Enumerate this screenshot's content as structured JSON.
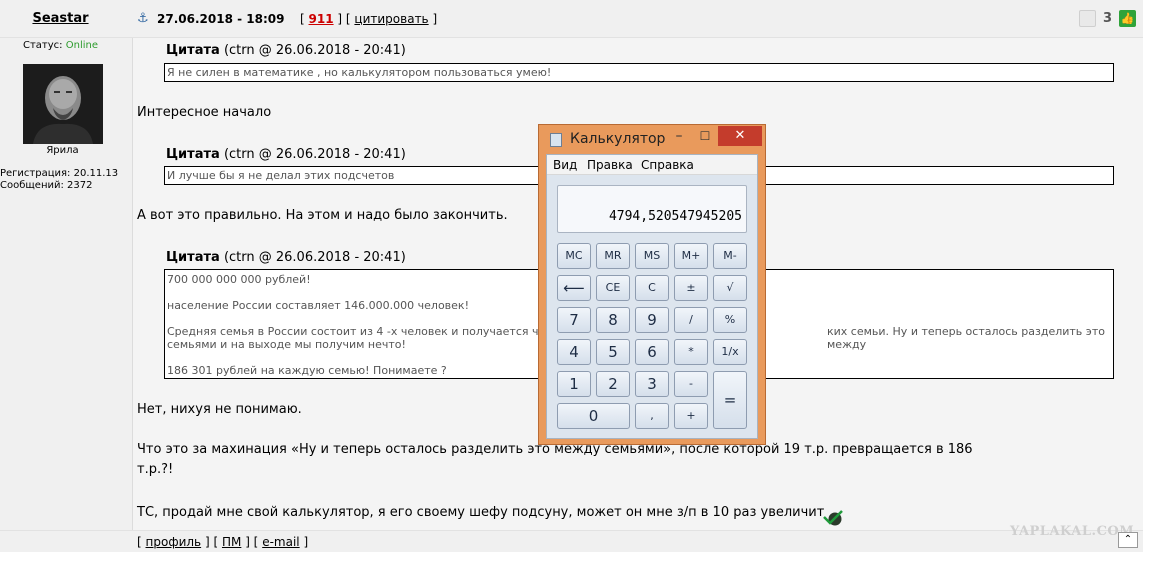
{
  "user": {
    "name": "Seastar",
    "status_label": "Статус:",
    "status_value": "Online",
    "avatar_caption": "Ярила",
    "registration": "Регистрация: 20.11.13",
    "messages": "Сообщений: 2372"
  },
  "post": {
    "date": "27.06.2018 - 18:09",
    "link_open": "[",
    "post_number": "911",
    "link_sep": "] [",
    "quote_link": "цитировать",
    "link_close": "]",
    "rating": "3"
  },
  "quotes": [
    {
      "author": "Цитата",
      "meta": "(ctrn @ 26.06.2018 - 20:41)",
      "lines": [
        "Я не силен в математике , но калькулятором пользоваться умею!"
      ]
    },
    {
      "author": "Цитата",
      "meta": "(ctrn @ 26.06.2018 - 20:41)",
      "lines": [
        "И лучше бы я не делал этих подсчетов"
      ]
    },
    {
      "author": "Цитата",
      "meta": "(ctrn @ 26.06.2018 - 20:41)",
      "lines": [
        "700 000 000 000 рублей!",
        "население России составляет 146.000.000 человек!",
        "Средняя семья в России состоит из 4 -х человек и получается что",
        "ких семьи. Ну и теперь осталось разделить это между",
        "семьями и на выходе мы получим нечто!",
        "186 301 рублей на каждую семью! Понимаете ?"
      ]
    }
  ],
  "paragraphs": [
    "Интересное начало",
    "А вот это правильно. На этом и надо было закончить.",
    "Нет, нихуя не понимаю.",
    "Что это за махинация «Ну и теперь осталось разделить это между семьями», после которой 19 т.р. превращается в 186",
    "т.р.?!",
    "ТС, продай мне свой калькулятор, я его своему шефу подсуну, может он мне з/п в 10 раз увеличит"
  ],
  "footer": {
    "open": "[",
    "profile": "профиль",
    "sep1": "] [",
    "pm": "ПМ",
    "sep2": "] [",
    "email": "e-mail",
    "close": "]"
  },
  "watermark": "YAPLAKAL.COM",
  "calculator": {
    "title": "Калькулятор",
    "menu": [
      "Вид",
      "Правка",
      "Справка"
    ],
    "display": "4794,520547945205",
    "close_glyph": "✕",
    "min_glyph": "–",
    "max_glyph": "☐",
    "keys": {
      "mc": "MC",
      "mr": "MR",
      "ms": "MS",
      "mplus": "M+",
      "mminus": "M-",
      "back": "⟵",
      "ce": "CE",
      "c": "C",
      "plusminus": "±",
      "sqrt": "√",
      "d7": "7",
      "d8": "8",
      "d9": "9",
      "div": "/",
      "pct": "%",
      "d4": "4",
      "d5": "5",
      "d6": "6",
      "mul": "*",
      "recip": "1/x",
      "d1": "1",
      "d2": "2",
      "d3": "3",
      "sub": "-",
      "eq": "=",
      "d0": "0",
      "comma": ",",
      "add": "+"
    }
  }
}
